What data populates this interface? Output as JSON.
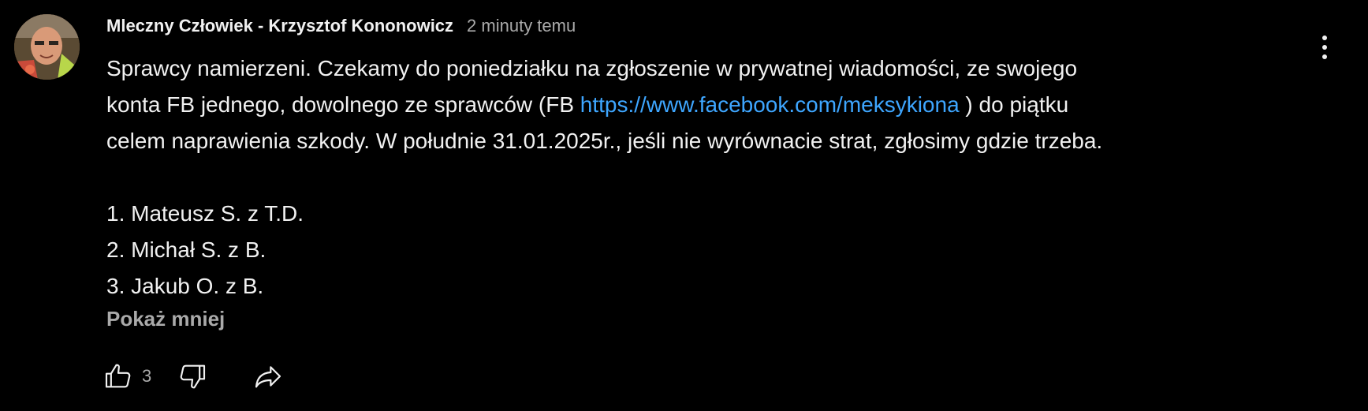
{
  "comment": {
    "author": "Mleczny Człowiek - Krzysztof Kononowicz",
    "timestamp": "2 minuty temu",
    "text_line_1": "Sprawcy namierzeni. Czekamy do poniedziałku na zgłoszenie w prywatnej wiadomości, ze swojego",
    "text_line_2_before_link": "konta FB jednego, dowolnego ze sprawców (FB ",
    "link_text": "https://www.facebook.com/meksykiona",
    "text_line_2_after_link": " ) do piątku",
    "text_line_3": "celem naprawienia szkody. W południe 31.01.2025r., jeśli nie wyrównacie strat, zgłosimy gdzie trzeba.",
    "list": [
      "1. Mateusz S. z T.D.",
      "2. Michał S. z B.",
      "3. Jakub O. z B."
    ],
    "show_less_label": "Pokaż mniej",
    "like_count": "3"
  },
  "icons": {
    "like": "thumbs-up-icon",
    "dislike": "thumbs-down-icon",
    "share": "share-icon",
    "menu": "more-vert-icon"
  },
  "colors": {
    "background": "#000000",
    "text": "#f1f1f1",
    "secondary_text": "#aaaaaa",
    "link": "#3ea6ff"
  }
}
